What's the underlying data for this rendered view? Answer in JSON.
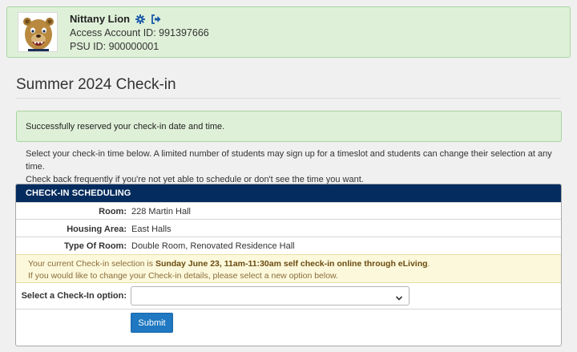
{
  "profile": {
    "name": "Nittany Lion",
    "access_account": "Access Account ID: 991397666",
    "psu_id": "PSU ID: 900000001",
    "icons": [
      "gear-icon",
      "sign-out-icon"
    ]
  },
  "page": {
    "title": "Summer 2024 Check-in"
  },
  "alert": {
    "message": "Successfully reserved your check-in date and time."
  },
  "intro": {
    "line1": "Select your check-in time below. A limited number of students may sign up for a timeslot and students can change their selection at any time.",
    "line2": "Check back frequently if you're not yet able to schedule or don't see the time you want."
  },
  "scheduling": {
    "header": "CHECK-IN SCHEDULING",
    "room_label": "Room:",
    "room_value": "228 Martin Hall",
    "housing_label": "Housing Area:",
    "housing_value": "East Halls",
    "type_label": "Type Of Room:",
    "type_value": "Double Room, Renovated Residence Hall",
    "notice_prefix": "Your current Check-in selection is ",
    "notice_selection": "Sunday June 23, 11am-11:30am self check-in online through eLiving",
    "notice_suffix": ".",
    "notice_line2": "If you would like to change your Check-in details, please select a new option below.",
    "select_label": "Select a Check-In option:",
    "select_value": "",
    "submit_label": "Submit"
  },
  "colors": {
    "header_bg": "#052c5e",
    "success_bg": "#dff0d8",
    "notice_bg": "#fcf8db",
    "button_bg": "#1f78c1"
  }
}
